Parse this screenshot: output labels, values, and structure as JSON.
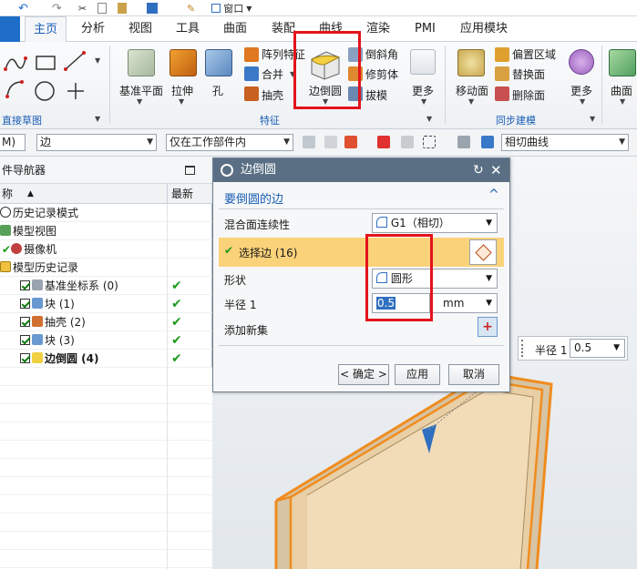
{
  "quick_access": {
    "window_menu": "窗口"
  },
  "menu": {
    "tabs": [
      "主页",
      "分析",
      "视图",
      "工具",
      "曲面",
      "装配",
      "曲线",
      "渲染",
      "PMI",
      "应用模块"
    ],
    "active_tab": "主页"
  },
  "ribbon": {
    "sketch_group": "直接草图",
    "feature_group": "特征",
    "sync_group": "同步建模",
    "datum_plane": "基准平面",
    "extrude": "拉伸",
    "hole": "孔",
    "pattern_feature": "阵列特征",
    "combine": "合并",
    "shell": "抽壳",
    "edge_blend": "边倒圆",
    "chamfer": "倒斜角",
    "trim_body": "修剪体",
    "draft": "拔模",
    "more_feature": "更多",
    "move_face": "移动面",
    "offset_region": "偏置区域",
    "replace_face": "替换面",
    "delete_face": "删除面",
    "more_sync": "更多",
    "surface": "曲面"
  },
  "toolbar": {
    "filter_partial": "M)",
    "selection_filter": "边",
    "scope": "仅在工作部件内",
    "curve_rule": "相切曲线"
  },
  "navigator": {
    "title": "件导航器",
    "col_name": "称",
    "col_latest": "最新",
    "items": [
      {
        "label": "历史记录模式"
      },
      {
        "label": "模型视图"
      },
      {
        "label": "摄像机"
      },
      {
        "label": "模型历史记录"
      },
      {
        "label": "基准坐标系 (0)"
      },
      {
        "label": "块 (1)"
      },
      {
        "label": "抽壳 (2)"
      },
      {
        "label": "块 (3)"
      },
      {
        "label": "边倒圆 (4)"
      }
    ]
  },
  "dialog": {
    "title": "边倒圆",
    "section": "要倒圆的边",
    "continuity_label": "混合面连续性",
    "continuity_value": "G1（相切）",
    "select_edge": "选择边 (16)",
    "shape_label": "形状",
    "shape_value": "圆形",
    "radius_label": "半径 1",
    "radius_value": "0.5",
    "radius_unit": "mm",
    "add_new_set": "添加新集",
    "ok": "< 确定 >",
    "apply": "应用",
    "cancel": "取消"
  },
  "radius_tag": {
    "label": "半径 1",
    "value": "0.5"
  }
}
